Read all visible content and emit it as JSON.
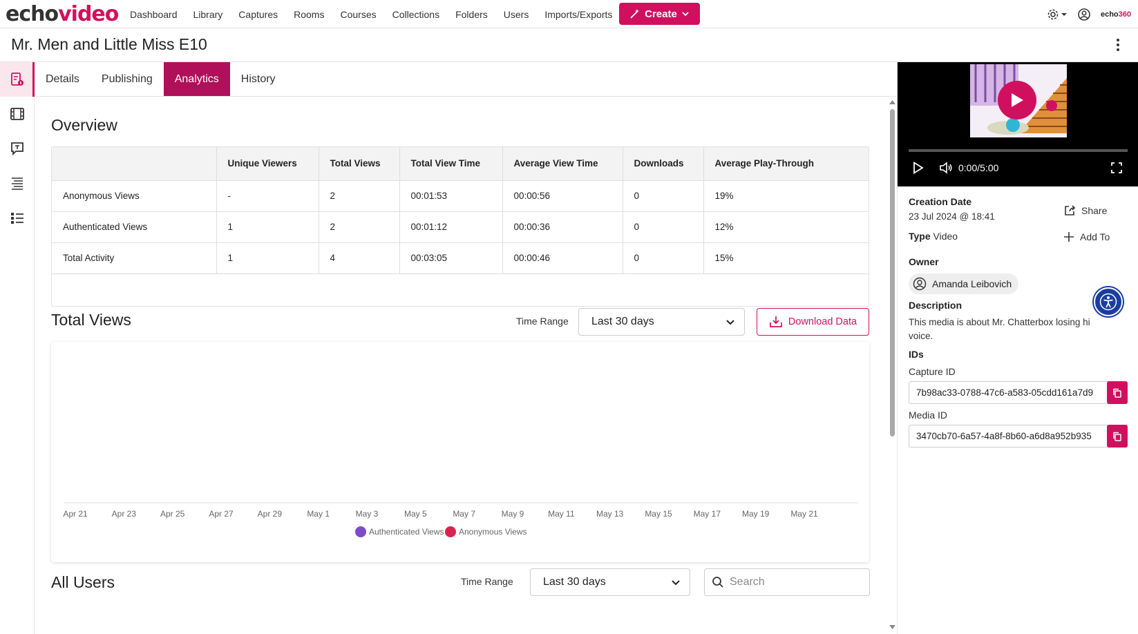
{
  "brand": {
    "logo_echo": "echo",
    "logo_video": "video",
    "corner_logo_a": "echo",
    "corner_logo_b": "360",
    "accent": "#d0105f"
  },
  "nav": {
    "items": [
      "Dashboard",
      "Library",
      "Captures",
      "Rooms",
      "Courses",
      "Collections",
      "Folders",
      "Users",
      "Imports/Exports"
    ],
    "create_label": "Create"
  },
  "page": {
    "title": "Mr. Men and Little Miss E10"
  },
  "tabs": [
    {
      "label": "Details",
      "active": false
    },
    {
      "label": "Publishing",
      "active": false
    },
    {
      "label": "Analytics",
      "active": true
    },
    {
      "label": "History",
      "active": false
    }
  ],
  "overview": {
    "title": "Overview",
    "columns": [
      "",
      "Unique Viewers",
      "Total Views",
      "Total View Time",
      "Average View Time",
      "Downloads",
      "Average Play-Through"
    ],
    "rows": [
      [
        "Anonymous Views",
        "-",
        "2",
        "00:01:53",
        "00:00:56",
        "0",
        "19%"
      ],
      [
        "Authenticated Views",
        "1",
        "2",
        "00:01:12",
        "00:00:36",
        "0",
        "12%"
      ],
      [
        "Total Activity",
        "1",
        "4",
        "00:03:05",
        "00:00:46",
        "0",
        "15%"
      ]
    ]
  },
  "total_views": {
    "title": "Total Views",
    "time_range_label": "Time Range",
    "time_range_value": "Last 30 days",
    "download_label": "Download Data"
  },
  "chart_data": {
    "type": "line",
    "title": "",
    "xlabel": "",
    "ylabel": "",
    "categories": [
      "Apr 21",
      "Apr 23",
      "Apr 25",
      "Apr 27",
      "Apr 29",
      "May 1",
      "May 3",
      "May 5",
      "May 7",
      "May 9",
      "May 11",
      "May 13",
      "May 15",
      "May 17",
      "May 19",
      "May 21"
    ],
    "series": [
      {
        "name": "Authenticated Views",
        "color": "#7e4cc9",
        "values": []
      },
      {
        "name": "Anonymous Views",
        "color": "#d6244f",
        "values": []
      }
    ],
    "legend": "bottom",
    "grid": false
  },
  "all_users": {
    "title": "All Users",
    "time_range_label": "Time Range",
    "time_range_value": "Last 30 days",
    "search_placeholder": "Search"
  },
  "player": {
    "time": "0:00/5:00"
  },
  "details": {
    "creation_label": "Creation Date",
    "creation_value": "23 Jul 2024 @ 18:41",
    "type_label": "Type",
    "type_value": "Video",
    "share_label": "Share",
    "addto_label": "Add To",
    "owner_label": "Owner",
    "owner_name": "Amanda Leibovich",
    "description_label": "Description",
    "description_line1": "This media is about Mr. Chatterbox losing hi",
    "description_line2": "voice.",
    "ids_label": "IDs",
    "capture_id_label": "Capture ID",
    "capture_id": "7b98ac33-0788-47c6-a583-05cdd161a7d9",
    "media_id_label": "Media ID",
    "media_id": "3470cb70-6a57-4a8f-8b60-a6d8a952b935"
  }
}
